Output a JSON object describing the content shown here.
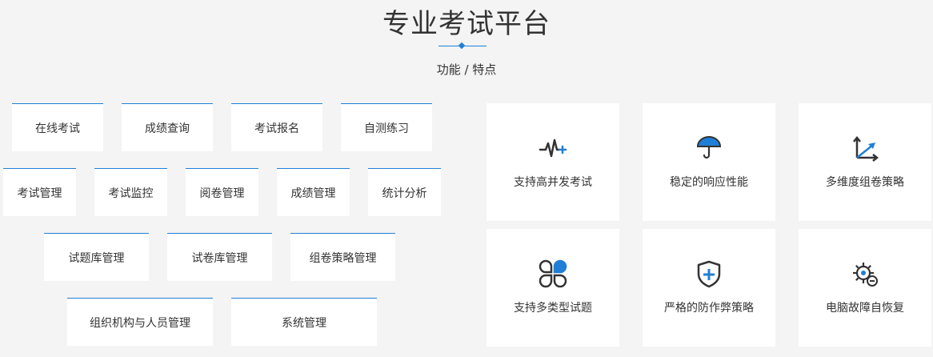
{
  "header": {
    "title": "专业考试平台",
    "subtitle": "功能 / 特点"
  },
  "features": [
    {
      "label": "在线考试"
    },
    {
      "label": "成绩查询"
    },
    {
      "label": "考试报名"
    },
    {
      "label": "自测练习"
    },
    {
      "label": "考试管理"
    },
    {
      "label": "考试监控"
    },
    {
      "label": "阅卷管理"
    },
    {
      "label": "成绩管理"
    },
    {
      "label": "统计分析"
    },
    {
      "label": "试题库管理"
    },
    {
      "label": "试卷库管理"
    },
    {
      "label": "组卷策略管理"
    },
    {
      "label": "组织机构与人员管理"
    },
    {
      "label": "系统管理"
    }
  ],
  "cards": [
    {
      "label": "支持高并发考试",
      "icon": "pulse-icon"
    },
    {
      "label": "稳定的响应性能",
      "icon": "umbrella-icon"
    },
    {
      "label": "多维度组卷策略",
      "icon": "axes-icon"
    },
    {
      "label": "支持多类型试题",
      "icon": "grid-icon"
    },
    {
      "label": "严格的防作弊策略",
      "icon": "shield-icon"
    },
    {
      "label": "电脑故障自恢复",
      "icon": "gear-icon"
    }
  ],
  "colors": {
    "accent": "#1f7fd6",
    "dark": "#333333",
    "background": "#f4f4f4"
  }
}
